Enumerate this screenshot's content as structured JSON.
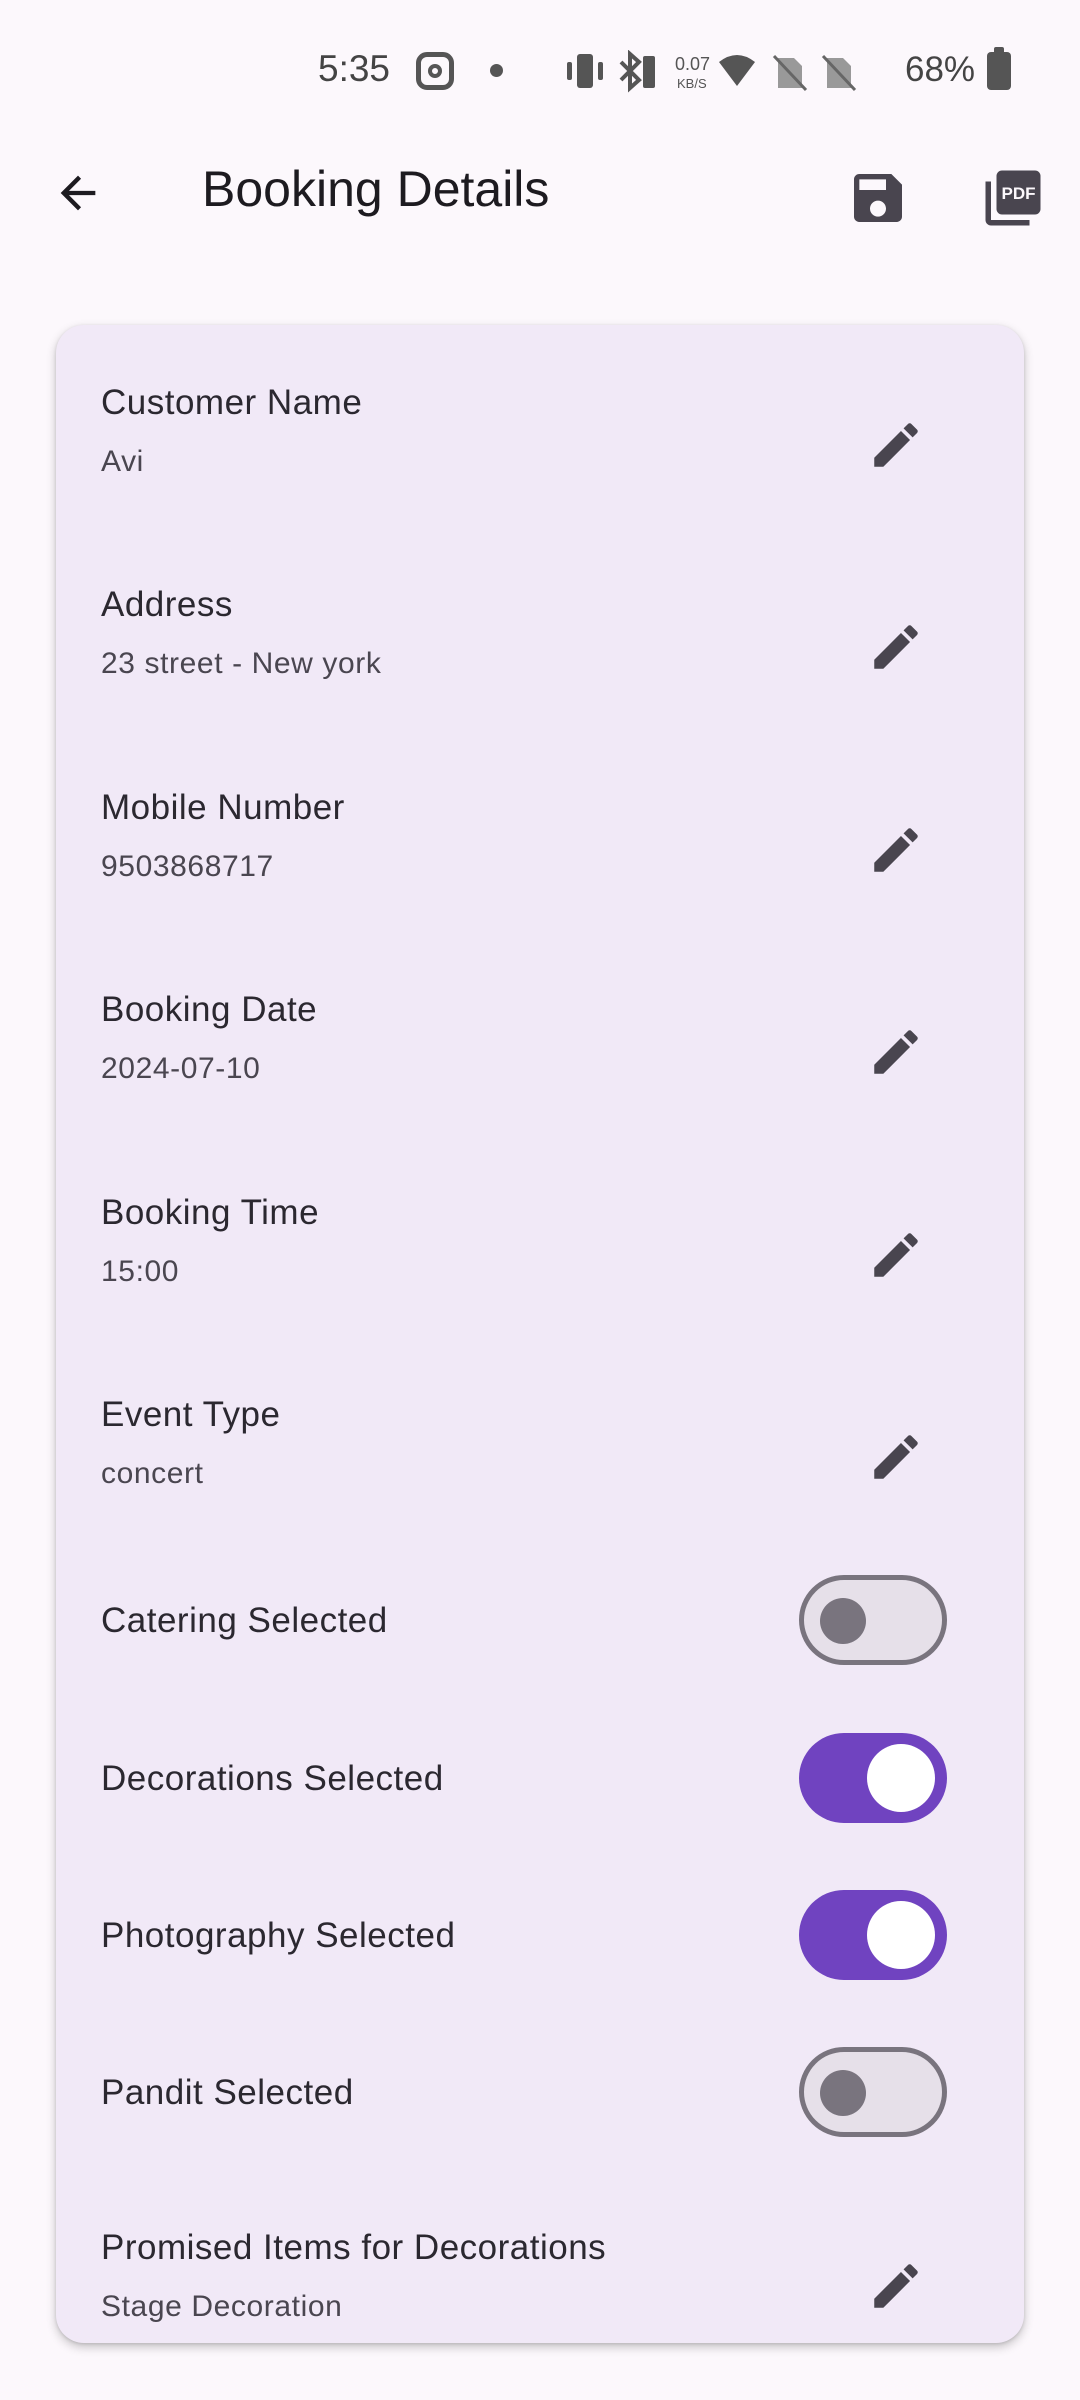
{
  "status_bar": {
    "time": "5:35",
    "net_speed_top": "0.07",
    "net_speed_bottom": "KB/S",
    "battery": "68%"
  },
  "app_bar": {
    "title": "Booking Details",
    "back_icon": "arrow-back-icon",
    "save_icon": "save-icon",
    "pdf_icon": "pdf-icon",
    "pdf_text": "PDF"
  },
  "fields": [
    {
      "label": "Customer Name",
      "value": "Avi"
    },
    {
      "label": "Address",
      "value": "23 street - New york"
    },
    {
      "label": "Mobile Number",
      "value": "9503868717"
    },
    {
      "label": "Booking Date",
      "value": "2024-07-10"
    },
    {
      "label": "Booking Time",
      "value": "15:00"
    },
    {
      "label": "Event Type",
      "value": "concert"
    }
  ],
  "toggles": [
    {
      "label": "Catering Selected",
      "on": false
    },
    {
      "label": "Decorations Selected",
      "on": true
    },
    {
      "label": "Photography Selected",
      "on": true
    },
    {
      "label": "Pandit Selected",
      "on": false
    }
  ],
  "promised": {
    "label": "Promised Items for Decorations",
    "value": "Stage Decoration"
  },
  "colors": {
    "background": "#fcf8fc",
    "card": "#f1e9f7",
    "accent": "#7043c0",
    "icon": "#49454f"
  }
}
